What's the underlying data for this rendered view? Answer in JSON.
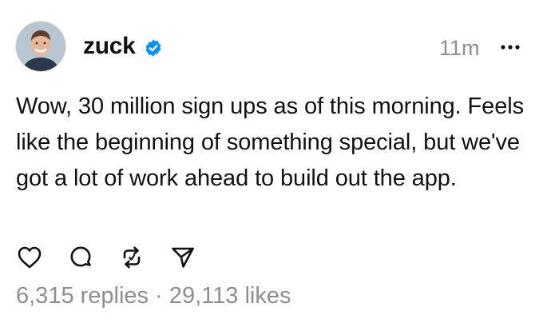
{
  "post": {
    "author": {
      "username": "zuck",
      "verified": true,
      "avatar_icon": "profile-photo"
    },
    "time_ago": "11m",
    "more_icon": "ellipsis-icon",
    "text": "Wow, 30 million sign ups as of this morning. Feels like the beginning of something special, but we've got a lot of work ahead to build out the app.",
    "actions": {
      "like_icon": "heart-icon",
      "reply_icon": "comment-icon",
      "repost_icon": "repost-icon",
      "share_icon": "send-icon"
    },
    "stats": {
      "replies": "6,315 replies",
      "separator": "·",
      "likes": "29,113 likes"
    }
  },
  "colors": {
    "text": "#111111",
    "muted": "#8e8e8e",
    "verified_blue": "#0095f6",
    "background": "#ffffff"
  }
}
